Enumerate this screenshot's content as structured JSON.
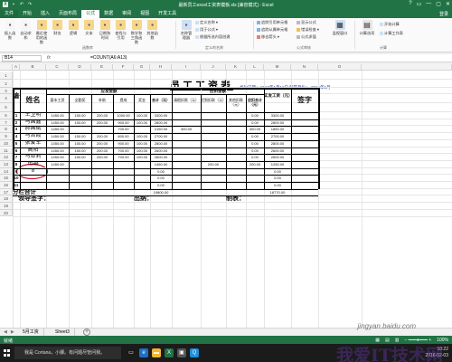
{
  "window": {
    "title": "最新员工excel工资表模板.xls [兼容模式] - Excel",
    "controls": [
      "?",
      "▭",
      "—",
      "▢",
      "✕"
    ]
  },
  "tabs": [
    "文件",
    "开始",
    "插入",
    "页面布局",
    "公式",
    "数据",
    "审阅",
    "视图",
    "开发工具"
  ],
  "login_label": "登录",
  "ribbon": {
    "buttons": [
      {
        "label": "插入函数",
        "icon": "fx-icon",
        "color": "#f6f6f6"
      },
      {
        "label": "自动求和",
        "icon": "sum-icon",
        "color": "#f6f6f6"
      },
      {
        "label": "最近使用的函数",
        "icon": "recent-icon",
        "color": "#f7d68a"
      },
      {
        "label": "财务",
        "icon": "finance-icon",
        "color": "#f7d68a"
      },
      {
        "label": "逻辑",
        "icon": "logic-icon",
        "color": "#f7d68a"
      },
      {
        "label": "文本",
        "icon": "text-icon",
        "color": "#f7d68a"
      },
      {
        "label": "日期和时间",
        "icon": "date-icon",
        "color": "#f7d68a"
      },
      {
        "label": "查找与引用",
        "icon": "lookup-icon",
        "color": "#f7d68a"
      },
      {
        "label": "数学和三角函数",
        "icon": "math-icon",
        "color": "#f7d68a"
      },
      {
        "label": "其他函数",
        "icon": "more-functions-icon",
        "color": "#f7d68a"
      },
      {
        "label": "名称管理器",
        "icon": "name-manager-icon",
        "color": "#cfe0f3"
      }
    ],
    "group_library": "函数库",
    "defined_names": [
      "定义名称 ▾",
      "用于公式 ▾",
      "根据所选内容创建"
    ],
    "group_names": "定义的名称",
    "audit": [
      "追踪引用单元格",
      "追踪从属单元格",
      "移去箭头 ▾"
    ],
    "audit2": [
      "显示公式",
      "错误检查 ▾",
      "公式求值"
    ],
    "watch_window": "监视窗口",
    "group_audit": "公式审核",
    "calc_options": "计算选项",
    "calc_now": "开始计算",
    "calc_sheet": "计算工作表",
    "group_calc": "计算"
  },
  "formula_bar": {
    "name_box": "B14",
    "fx": "fx",
    "formula": "=COUNT(A6:A13)"
  },
  "columns": [
    "A",
    "B",
    "C",
    "D",
    "E",
    "F",
    "G",
    "H",
    "I",
    "J",
    "K",
    "L",
    "M",
    "N",
    "O"
  ],
  "rows": [
    "1",
    "2",
    "3",
    "4",
    "5",
    "6",
    "7",
    "8",
    "9",
    "10",
    "11",
    "12",
    "13",
    "14",
    "15",
    "16",
    "17",
    "18",
    "19",
    "20"
  ],
  "sheet": {
    "title": "员工工资表",
    "unit": "发放日期：",
    "date_info": "2016年1月12日",
    "month_label": "所属月份：",
    "month": "2016年1月",
    "headers": {
      "no": "编号",
      "name": "姓名",
      "pay_items": "应发金额",
      "deductions": "应扣金额",
      "actual": "实发工资（元）",
      "signature": "签字",
      "base": "基本工资",
      "bonus": "全勤奖",
      "allowance": "补助",
      "commission": "提成",
      "award": "奖金",
      "subtotal": "合计（元）",
      "late": "请假扣款（元）",
      "absent": "迟到扣款（元）",
      "other": "其他扣款（元）",
      "ded_total": "应扣合计（元）"
    },
    "employees": [
      {
        "no": "1",
        "name": "王卫明",
        "base": "1450.00",
        "bonus": "150.00",
        "allowance": "200.00",
        "commission": "1000.00",
        "award": "100.00",
        "subtotal": "3300.00",
        "late": "",
        "absent": "",
        "other": "",
        "ded_total": "0.00",
        "actual": "3300.00"
      },
      {
        "no": "2",
        "name": "马国鑫",
        "base": "1450.00",
        "bonus": "150.00",
        "allowance": "200.00",
        "commission": "900.00",
        "award": "100.00",
        "subtotal": "2800.00",
        "late": "",
        "absent": "",
        "other": "",
        "ded_total": "0.00",
        "actual": "2800.00"
      },
      {
        "no": "3",
        "name": "郝国斌",
        "base": "1450.00",
        "bonus": "",
        "allowance": "",
        "commission": "700.00",
        "award": "",
        "subtotal": "2150.00",
        "late": "300.00",
        "absent": "",
        "other": "",
        "ded_total": "300.00",
        "actual": "1850.00"
      },
      {
        "no": "4",
        "name": "马晋霞",
        "base": "1450.00",
        "bonus": "150.00",
        "allowance": "200.00",
        "commission": "800.00",
        "award": "100.00",
        "subtotal": "2700.00",
        "late": "",
        "absent": "",
        "other": "",
        "ded_total": "0.00",
        "actual": "2700.00"
      },
      {
        "no": "5",
        "name": "张爱军",
        "base": "1450.00",
        "bonus": "150.00",
        "allowance": "200.00",
        "commission": "900.00",
        "award": "100.00",
        "subtotal": "2800.00",
        "late": "",
        "absent": "",
        "other": "",
        "ded_total": "0.00",
        "actual": "2800.00"
      },
      {
        "no": "6",
        "name": "高阳",
        "base": "1450.00",
        "bonus": "150.00",
        "allowance": "200.00",
        "commission": "700.00",
        "award": "100.00",
        "subtotal": "2600.00",
        "late": "",
        "absent": "",
        "other": "",
        "ded_total": "0.00",
        "actual": "2600.00"
      },
      {
        "no": "7",
        "name": "马亚莉",
        "base": "1450.00",
        "bonus": "150.00",
        "allowance": "200.00",
        "commission": "700.00",
        "award": "100.00",
        "subtotal": "2600.00",
        "late": "",
        "absent": "",
        "other": "",
        "ded_total": "0.00",
        "actual": "2600.00"
      },
      {
        "no": "8",
        "name": "迅越",
        "base": "1450.00",
        "bonus": "",
        "allowance": "",
        "commission": "",
        "award": "",
        "subtotal": "1450.00",
        "late": "",
        "absent": "200.00",
        "other": "",
        "ded_total": "200.00",
        "actual": "1250.00"
      },
      {
        "no": "9",
        "name": "8",
        "base": "",
        "bonus": "",
        "allowance": "",
        "commission": "",
        "award": "",
        "subtotal": "0.00",
        "late": "",
        "absent": "",
        "other": "",
        "ded_total": "",
        "actual": "0.00"
      },
      {
        "no": "10",
        "name": "",
        "base": "",
        "bonus": "",
        "allowance": "",
        "commission": "",
        "award": "",
        "subtotal": "0.00",
        "late": "",
        "absent": "",
        "other": "",
        "ded_total": "",
        "actual": "0.00"
      },
      {
        "no": "11",
        "name": "",
        "base": "",
        "bonus": "",
        "allowance": "",
        "commission": "",
        "award": "",
        "subtotal": "0.00",
        "late": "",
        "absent": "",
        "other": "",
        "ded_total": "",
        "actual": "0.00"
      }
    ],
    "total_label": "分栏合计",
    "total_subtotal": "19800.00",
    "total_actual": "18770.00",
    "footer_leader": "领导签字：",
    "footer_cashier": "出纳：",
    "footer_maker": "制表："
  },
  "sheet_tabs": [
    "5月工资",
    "Sheet3"
  ],
  "active_sheet_tab": "5月工资",
  "status": {
    "ready": "就绪",
    "zoom": "100%"
  },
  "taskbar": {
    "search": "我是 Cortana，小娜。有问题尽管问我。",
    "time": "10:22",
    "date": "2016-02-03"
  },
  "watermark": "我爱IT技术网",
  "watermark_url": "jingyan.baidu.com",
  "colors": {
    "excel_green": "#217346",
    "selection_circle": "#d0021b",
    "title_blue": "#1f3d8a"
  }
}
